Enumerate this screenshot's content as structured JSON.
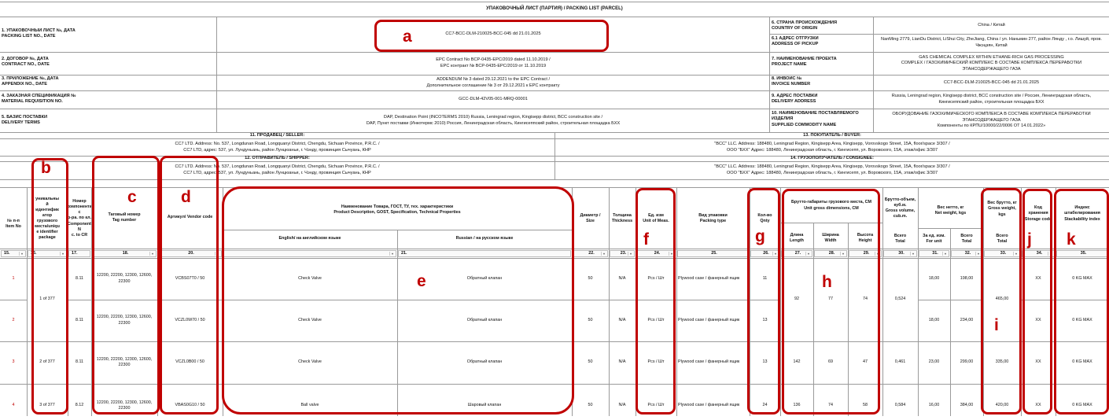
{
  "doc_title": "УПАКОВОЧНЫЙ ЛИСТ (ПАРТИЯ) / PACKING LIST (PARCEL)",
  "left_fields": [
    {
      "label": "1. УПАКОВОЧНЫЙ ЛИСТ №, ДАТА\nPACKING LIST NO., DATE",
      "value": "CC7-BCC-DLM-210025-BCC-045 dd 21.01.2025"
    },
    {
      "label": "2. ДОГОВОР №, ДАТА\nCONTRACT NO., DATE",
      "value": "EPC Contract No BCP-0435-EPC/2019 dated 11.10.2019 /\nEPC контракт № BCP-0435-EPC/2019 от 11.10.2019"
    },
    {
      "label": "3. ПРИЛОЖЕНИЕ №, ДАТА\nAPPENDIX NO., DATE",
      "value": "ADDENDUM № 3 dated 29.12.2021 to the EPC Contract /\nДополнительное соглашение № 3 от 29.12.2021 к EPC контракту"
    },
    {
      "label": "4. ЗАКАЗНАЯ СПЕЦИФИКАЦИЯ №\nMATERIAL REQUISITION NO.",
      "value": "GCC-DLM-42V05-001-MRQ-00001"
    },
    {
      "label": "5.  БАЗИС ПОСТАВКИ\nDELIVERY TERMS",
      "value": "DAP, Destination Point (INCOTERMS 2010) Russia, Leningrad region, Kingisepp district, BCC construction site /\nDAP, Пункт поставки (Инкотермс 2010) Россия, Ленинградская область, Кингисеппский район, строительная площадка БХХ"
    }
  ],
  "right_fields": [
    {
      "label": "6. СТРАНА ПРОИСХОЖДЕНИЯ\nCOUNTRY OF ORIGIN",
      "value": "China / Китай"
    },
    {
      "label": "6.1 АДРЕС ОТГРУЗКИ\nADDRESS OF PICKUP",
      "value": "NanMing 2779, LianDu District, LiShui City, ZheJiang, China / ул. Наньмин 277, район Лянду , г.о. Лишуй, пров. Чжэцзян, Китай"
    },
    {
      "label": "7. НАИМЕНОВАНИЕ ПРОЕКТА\nPROJECT NAME",
      "value": "GAS CHEMICAL COMPLEX WITHIN ETHANE-RICH GAS PROCESSING\nCOMPLEX / ГАЗОХИМИЧЕСКИЙ КОМПЛЕКС В СОСТАВЕ КОМПЛЕКСА ПЕРЕРАБОТКИ\nЭТАНСОДЕРЖАЩЕГО ГАЗА"
    },
    {
      "label": "8. ИНВОЙС №\nINVOICE NUMBER",
      "value": "CC7-BCC-DLM-210025-BCC-045 dd 21.01.2025"
    },
    {
      "label": "9. АДРЕС ПОСТАВКИ\nDELIVERY ADDRESS",
      "value": "Russia, Leningrad region, Kingisepp district, BCC construction site / Россия, Ленинградская область,\nКингисеппский район, строительная площадка БХХ"
    },
    {
      "label": "10. НАИМЕНОВАНИЕ ПОСТАВЛЯЕМОГО\nИЗДЕЛИЯ\nSUPPLIED COMMODITY NAME",
      "value": "ОБОРУДОВАНИЕ ГАЗОХИМИЧЕСКОГО КОМПЛЕКСА В СОСТАВЕ КОМПЛЕКСА ПЕРЕРАБОТКИ\nЭТАНСОДЕРЖАЩЕГО ГАЗА\nКомпоненты по КРПU/10000/22/0006 ОТ 14.01.2022»"
    }
  ],
  "parties": {
    "seller_title": "11. ПРОДАВЕЦ / SELLER:",
    "seller_text": "CC7 LTD. Address: No. 537, Longdunan Road, Longquanyi District, Chengdu, Sichuan Province, P.R.C. /\nCC7 LTD, адрес: 537, ул. Лундуньань, район Лунцюаньи, г. Чэнду, провинция Сычуань, КНР",
    "buyer_title": "13. ПОКУПАТЕЛЬ / BUYER:",
    "buyer_text": "\"BCC\" LLC. Address: 188480, Leningrad Region, Kingisepp Area, Kingisepp, Vorovskogo Street, 15A, floor/space 3/307  /\nООО \"БХХ\" Адрес: 188480, Ленинградская область, г. Кингисепп, ул. Воровского, 15А, этаж/офис 3/307",
    "shipper_title": "12. ОТПРАВИТЕЛЬ / SHIPPER:",
    "shipper_text": "CC7 LTD. Address: No. 537, Longdunan Road, Longquanyi District, Chengdu, Sichuan Province, P.R.C. /\nCC7 LTD, адрес: 537, ул. Лундуньань, район Лунцюаньи, г. Чэнду, провинция Сычуань, КНР",
    "consignee_title": "14. ГРУЗОПОЛУЧАТЕЛЬ / CONSIGNEE:",
    "consignee_text": "\"BCC\" LLC. Address: 188480, Leningrad Region, Kingisepp Area, Kingisepp, Vorovskogo Street, 15A, floor/space 3/307  /\nООО \"БХХ\" Адрес: 188480, Ленинградская область, г. Кингисепп, ул. Воровского, 15А, этаж/офис 3/307"
  },
  "headers": {
    "item_no": "№ п-п\nItem No",
    "unique_id": "уникальны\nй\nидентифик\nатор\nгрузового\nместа/uniqu\ne identifier\npackage",
    "component_no": "Номер\nкомпонента с\nр-ра. по кл.\nComponent N\nc. to CR",
    "tag_number": "Таговый номер\nTag number",
    "vendor_code": "Артикул/ Vendor code",
    "description": "Наименование Товара, ГОСТ, ТУ, тех. характеристики\nProduct Description, GOST, Specification, Technical Properties",
    "english": "English/ на английском языке",
    "russian": "Russian / на русском языке",
    "diameter": "Диаметр /\nSize",
    "thickness": "Толщина\nThickness",
    "unit": "Ед. изм\nUnit of Meas.",
    "packing_type": "Вид упаковки\nPacking type",
    "qnty": "Кол-во\nQnty",
    "gross_dims": "Брутто-габариты грузового места, СМ\nUnit gross dimensions, CM",
    "length": "Длина\nLength",
    "width": "Ширина\nWidth",
    "height": "Высота\nHeight",
    "gross_volume": "Брутто-объем,\nкуб.м.\nGross volume,\ncub.m.",
    "volume_total": "Всего\nTotal",
    "net_weight": "Вес нетто, кг\nNet weight, kgs",
    "net_for_unit": "За ед. изм.\nFor unit",
    "net_total": "Всего\nTotal",
    "gross_weight": "Вес брутто, кг\nGross weight,\nkgs",
    "gross_total": "Всего\nTotal",
    "storage": "Код\nхранения\nStorage code",
    "stack": "Индекс\nштабелирования\nStackability index"
  },
  "col_numbers": [
    "15.",
    "16.",
    "17.",
    "18.",
    "20.",
    "21.",
    "22.",
    "23.",
    "24.",
    "25.",
    "26.",
    "27.",
    "28.",
    "29.",
    "30.",
    "31.",
    "32.",
    "33.",
    "34.",
    "35."
  ],
  "rows": [
    {
      "item": "1",
      "comp": "8.11",
      "tag": "12200, 22200, 12300, 12600,\n22300",
      "vendor": "VCBS07T0 / 50",
      "en": "Check Valve",
      "ru": "Обратный клапан",
      "dia": "50",
      "thk": "N/A",
      "unit": "Pcs / Шт",
      "pack": "Plywood case / фанерный ящик",
      "qty": "11",
      "net_unit": "18,00",
      "net_total": "198,00",
      "storage": "XX",
      "stack": "0 KG MAX"
    },
    {
      "item": "2",
      "comp": "8.11",
      "tag": "12200, 22200, 12300, 12600,\n22300",
      "vendor": "VCZL0W70 / 50",
      "en": "Check Valve",
      "ru": "Обратный клапан",
      "dia": "50",
      "thk": "N/A",
      "unit": "Pcs / Шт",
      "pack": "Plywood case / фанерный ящик",
      "qty": "13",
      "net_unit": "18,00",
      "net_total": "234,00",
      "storage": "XX",
      "stack": "0 KG MAX"
    },
    {
      "item": "3",
      "comp": "8.11",
      "tag": "12200, 22200, 12300, 12600,\n22300",
      "vendor": "VCZL0B00 / 50",
      "en": "Check Valve",
      "ru": "Обратный клапан",
      "dia": "50",
      "thk": "N/A",
      "unit": "Pcs / Шт",
      "pack": "Plywood case / фанерный ящик",
      "qty": "13",
      "net_unit": "23,00",
      "net_total": "299,00",
      "storage": "XX",
      "stack": "0 KG MAX"
    },
    {
      "item": "4",
      "comp": "8.12",
      "tag": "12200, 22200, 12300, 12600,\n22300",
      "vendor": "VBAS0G10 / 50",
      "en": "Ball valve",
      "ru": "Шаровый клапан",
      "dia": "50",
      "thk": "N/A",
      "unit": "Pcs / Шт",
      "pack": "Plywood case / фанерный ящик",
      "qty": "24",
      "net_unit": "16,00",
      "net_total": "384,00",
      "storage": "XX",
      "stack": "0 KG MAX"
    }
  ],
  "packages": [
    {
      "uid": "1 of 377",
      "length": "92",
      "width": "77",
      "height": "74",
      "volume": "0,524",
      "gross": "465,00"
    },
    {
      "uid": "2 of 377",
      "length": "142",
      "width": "69",
      "height": "47",
      "volume": "0,461",
      "gross": "335,00"
    },
    {
      "uid": "3 of 377",
      "length": "136",
      "width": "74",
      "height": "58",
      "volume": "0,584",
      "gross": "420,00"
    }
  ],
  "callouts": [
    "a",
    "b",
    "c",
    "d",
    "e",
    "f",
    "g",
    "h",
    "i",
    "j",
    "k"
  ],
  "callout_color": "#c00000"
}
